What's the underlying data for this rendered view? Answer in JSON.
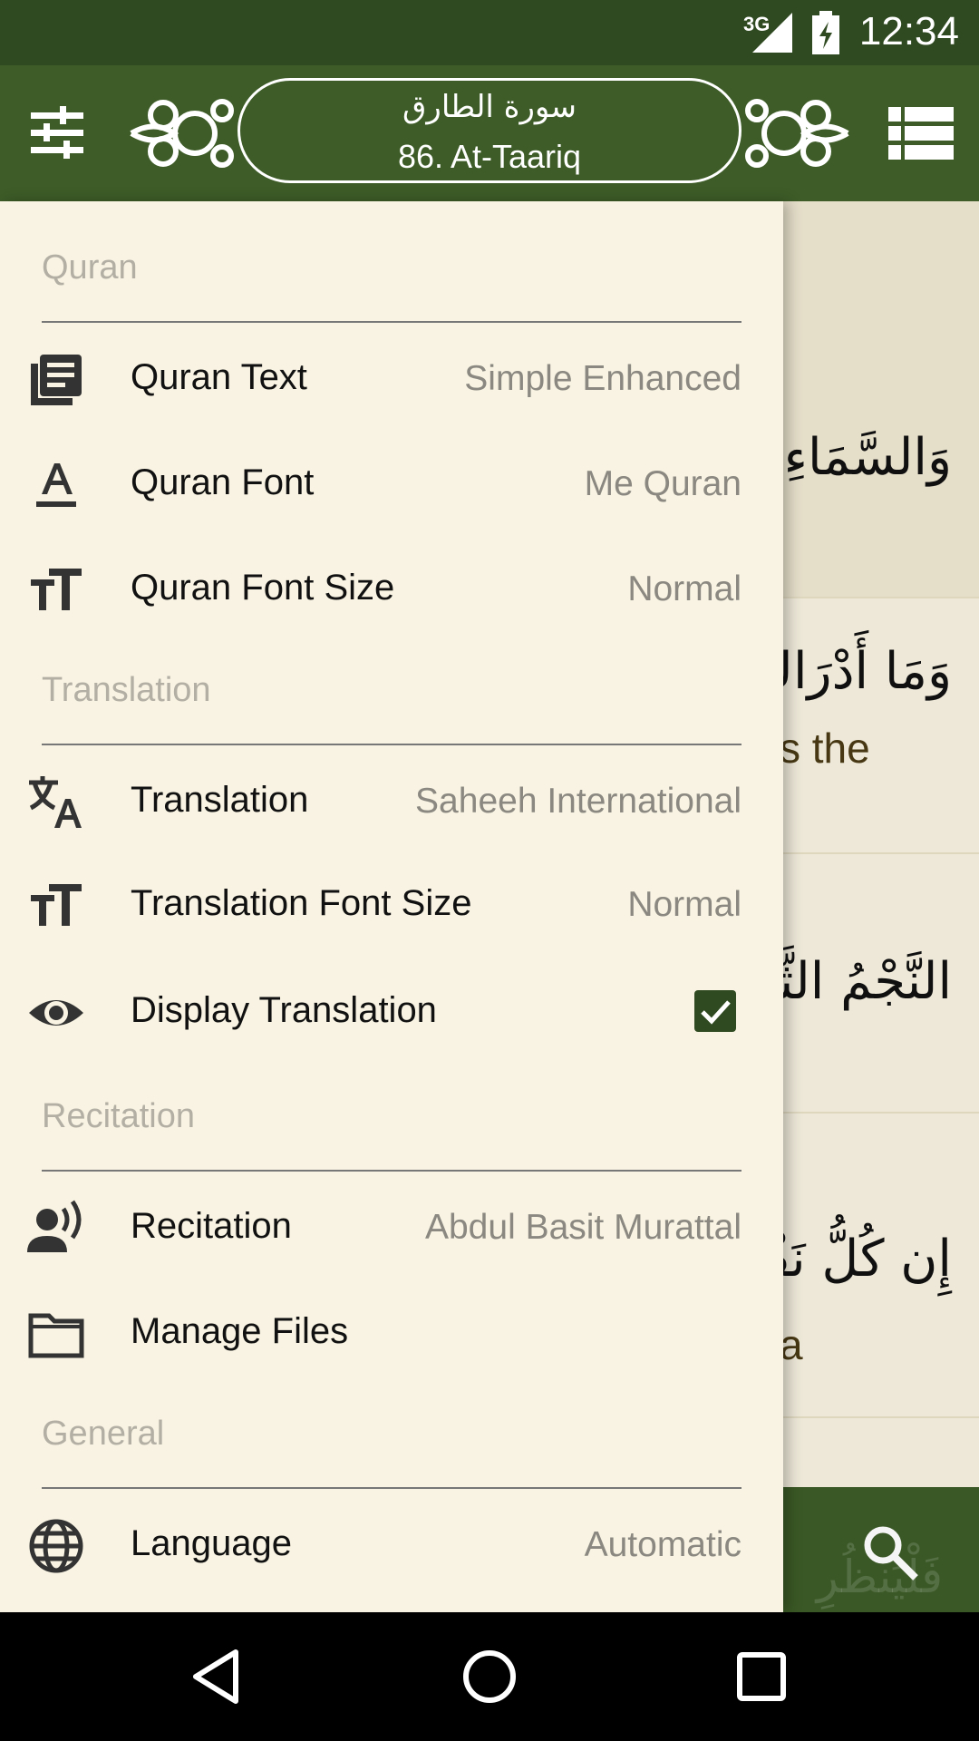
{
  "status_bar": {
    "time": "12:34",
    "network": "3G"
  },
  "app_bar": {
    "surah_arabic": "سورة الطارق",
    "surah_english": "86. At-Taariq",
    "menu_icon": "tune-icon",
    "list_icon": "list-view-icon"
  },
  "reader": {
    "ayahs": [
      {
        "arabic": "وَالسَّمَاءِ",
        "english": ""
      },
      {
        "arabic": "وَمَا أَدْرَاكَ",
        "english": "s the"
      },
      {
        "arabic": "النَّجْمُ الثَّاقِبُ",
        "english": ""
      },
      {
        "arabic": "إِن كُلُّ نَفْسٍ",
        "english": "a"
      }
    ],
    "bottom_arabic": "فَلْيَنظُرِ",
    "search_icon": "search-icon"
  },
  "drawer": {
    "sections": [
      {
        "header": "Quran"
      },
      {
        "header": "Translation"
      },
      {
        "header": "Recitation"
      },
      {
        "header": "General"
      }
    ],
    "items": [
      {
        "title": "Quran Text",
        "value": "Simple Enhanced",
        "icon": "book-pages-icon"
      },
      {
        "title": "Quran Font",
        "value": "Me Quran",
        "icon": "font-icon"
      },
      {
        "title": "Quran Font Size",
        "value": "Normal",
        "icon": "text-size-icon"
      },
      {
        "title": "Translation",
        "value": "Saheeh International",
        "icon": "translate-icon"
      },
      {
        "title": "Translation Font Size",
        "value": "Normal",
        "icon": "text-size-icon"
      },
      {
        "title": "Display Translation",
        "value": "",
        "checked": true,
        "icon": "eye-icon"
      },
      {
        "title": "Recitation",
        "value": "Abdul Basit Murattal",
        "icon": "voice-icon"
      },
      {
        "title": "Manage Files",
        "value": "",
        "icon": "folder-icon"
      },
      {
        "title": "Language",
        "value": "Automatic",
        "icon": "globe-icon"
      }
    ]
  },
  "colors": {
    "primary": "#3d5c27",
    "status": "#2f4a20",
    "background": "#f7f2e1"
  },
  "nav_bar": {
    "back_icon": "back-icon",
    "home_icon": "home-icon",
    "recents_icon": "recents-icon"
  }
}
